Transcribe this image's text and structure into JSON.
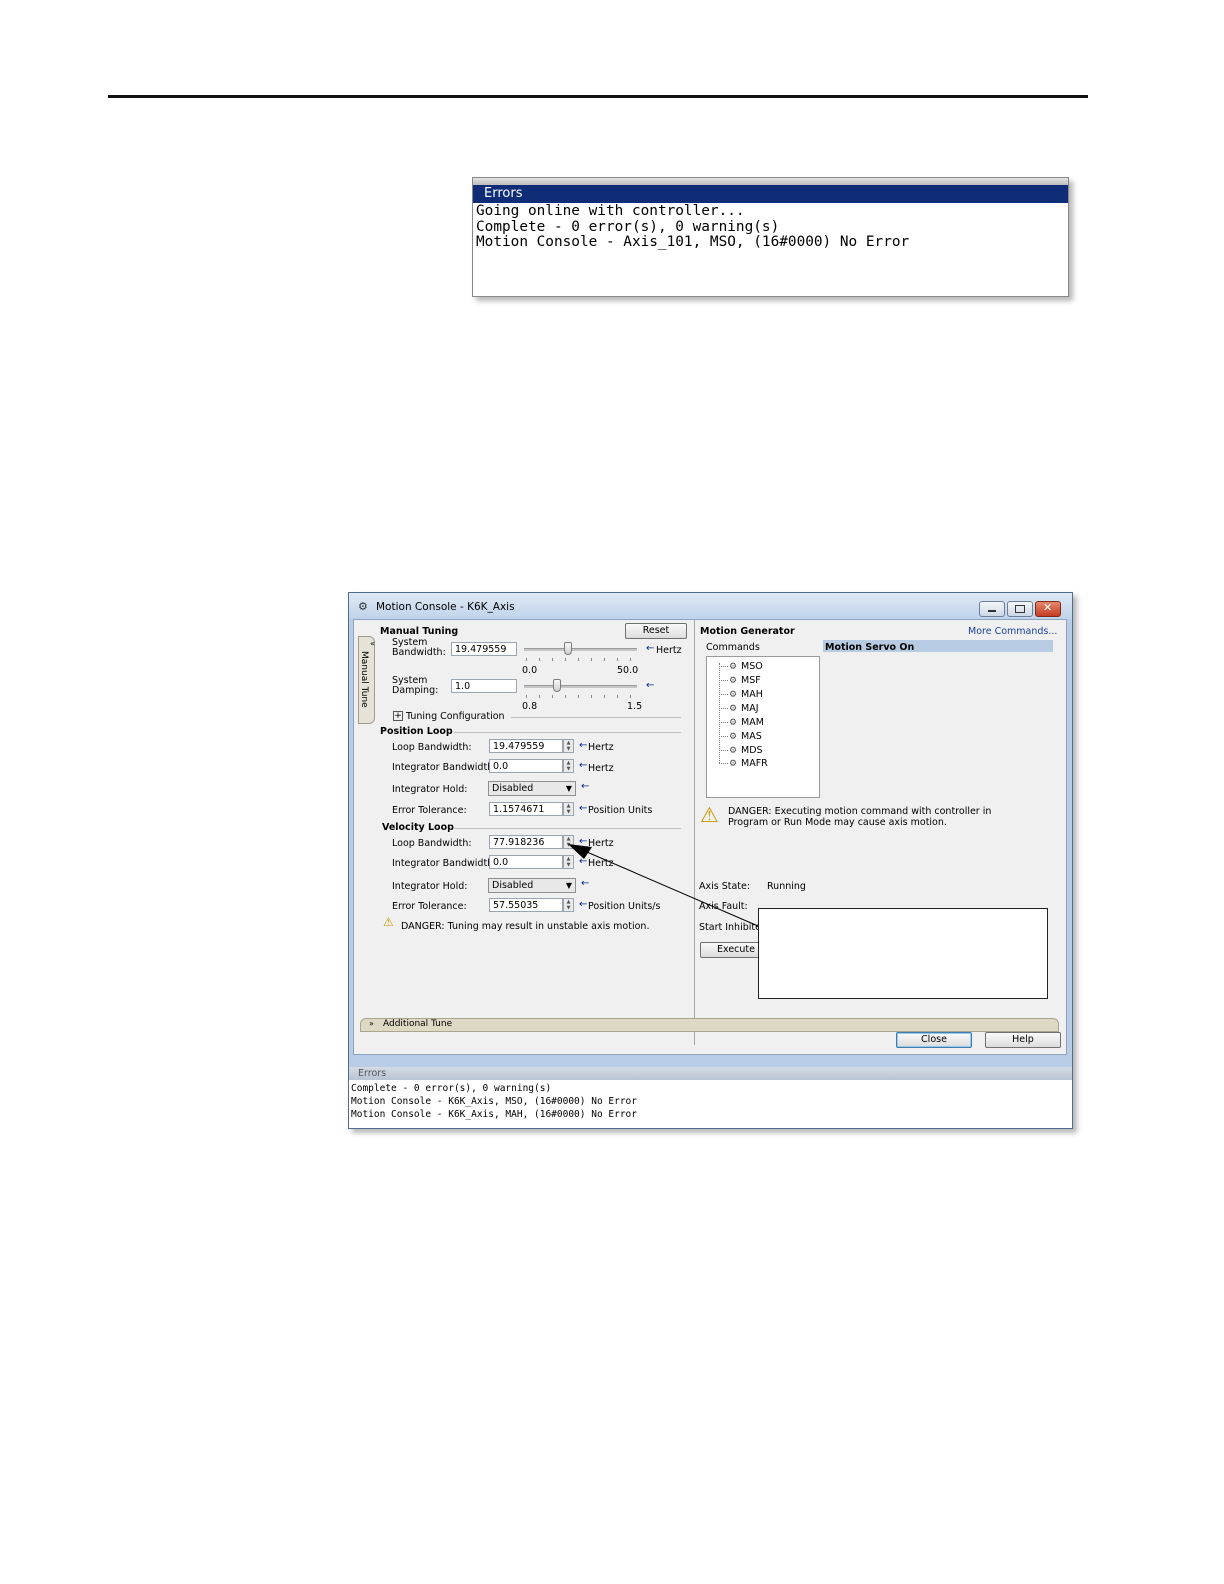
{
  "errors_window_top": {
    "title": "Errors",
    "lines": [
      "Going online with controller...",
      "Complete - 0 error(s), 0 warning(s)",
      "Motion Console - Axis_101, MSO, (16#0000) No Error"
    ]
  },
  "motion_console": {
    "title": "Motion Console - K6K_Axis",
    "side_tab": "Manual Tune",
    "manual_tuning": {
      "heading": "Manual Tuning",
      "reset_label": "Reset",
      "system_bandwidth_label": "System\nBandwidth:",
      "system_bandwidth_value": "19.479559",
      "bandwidth_unit": "Hertz",
      "bandwidth_min": "0.0",
      "bandwidth_max": "50.0",
      "bandwidth_level": 0.39,
      "system_damping_label": "System\nDamping:",
      "system_damping_value": "1.0",
      "damping_min": "0.8",
      "damping_max": "1.5",
      "damping_level": 0.29,
      "tuning_configuration": "Tuning Configuration"
    },
    "position_loop": {
      "heading": "Position Loop",
      "loop_bandwidth_label": "Loop Bandwidth:",
      "loop_bandwidth_value": "19.479559",
      "loop_bandwidth_unit": "Hertz",
      "integrator_bandwidth_label": "Integrator Bandwidth:",
      "integrator_bandwidth_value": "0.0",
      "integrator_bandwidth_unit": "Hertz",
      "integrator_hold_label": "Integrator Hold:",
      "integrator_hold_value": "Disabled",
      "error_tolerance_label": "Error Tolerance:",
      "error_tolerance_value": "1.1574671",
      "error_tolerance_unit": "Position Units"
    },
    "velocity_loop": {
      "heading": "Velocity Loop",
      "loop_bandwidth_label": "Loop Bandwidth:",
      "loop_bandwidth_value": "77.918236",
      "loop_bandwidth_unit": "Hertz",
      "integrator_bandwidth_label": "Integrator Bandwidth:",
      "integrator_bandwidth_value": "0.0",
      "integrator_bandwidth_unit": "Hertz",
      "integrator_hold_label": "Integrator Hold:",
      "integrator_hold_value": "Disabled",
      "error_tolerance_label": "Error Tolerance:",
      "error_tolerance_value": "57.55035",
      "error_tolerance_unit": "Position Units/s"
    },
    "tuning_danger": "DANGER: Tuning may result in unstable axis motion.",
    "motion_generator": {
      "heading": "Motion Generator",
      "more_commands": "More Commands...",
      "commands_label": "Commands",
      "selected_command": "Motion Servo On",
      "commands": [
        "MSO",
        "MSF",
        "MAH",
        "MAJ",
        "MAM",
        "MAS",
        "MDS",
        "MAFR"
      ],
      "danger_line1": "DANGER: Executing motion command with controller in",
      "danger_line2": "Program or Run Mode may cause axis motion.",
      "axis_state_label": "Axis State:",
      "axis_state_value": "Running",
      "axis_fault_label": "Axis Fault:",
      "start_inhibited_label": "Start Inhibited",
      "execute_label": "Execute"
    },
    "additional_tune": "Additional Tune",
    "close_label": "Close",
    "help_label": "Help",
    "errors_pane": {
      "title": "Errors",
      "lines": [
        "Complete - 0 error(s), 0 warning(s)",
        "Motion Console - K6K_Axis, MSO, (16#0000) No Error",
        "Motion Console - K6K_Axis, MAH, (16#0000) No Error"
      ]
    }
  }
}
